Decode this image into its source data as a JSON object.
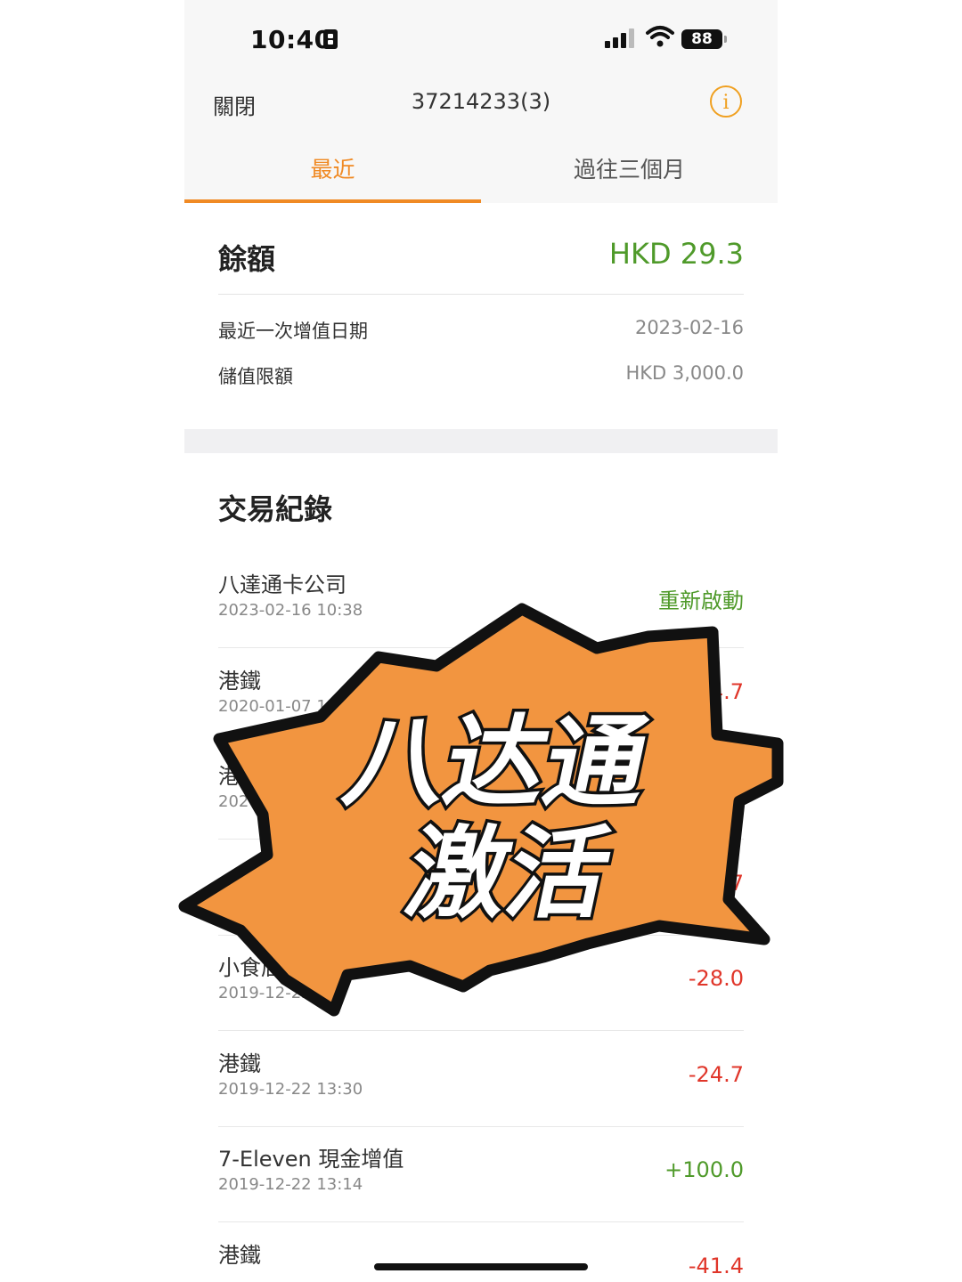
{
  "status_bar": {
    "time": "10:40",
    "battery": "88"
  },
  "nav": {
    "close_label": "關閉",
    "title": "37214233(3)",
    "info_icon": "i"
  },
  "tabs": [
    {
      "label": "最近"
    },
    {
      "label": "過往三個月"
    }
  ],
  "balance": {
    "label": "餘額",
    "value": "HKD 29.3",
    "details": [
      {
        "label": "最近一次增值日期",
        "value": "2023-02-16"
      },
      {
        "label": "儲值限額",
        "value": "HKD 3,000.0"
      }
    ]
  },
  "transactions": {
    "heading": "交易紀錄",
    "items": [
      {
        "merchant": "八達通卡公司",
        "date": "2023-02-16 10:38",
        "amount": "重新啟動",
        "kind": "pos"
      },
      {
        "merchant": "港鐵",
        "date": "2020-01-07 13:3",
        "amount": "4.7",
        "kind": "neg"
      },
      {
        "merchant": "港鐵",
        "date": "2020",
        "amount": "",
        "kind": "neg"
      },
      {
        "merchant": "",
        "date": "",
        "amount": "7",
        "kind": "neg"
      },
      {
        "merchant": "小食店",
        "date": "2019-12-22 1",
        "amount": "-28.0",
        "kind": "neg"
      },
      {
        "merchant": "港鐵",
        "date": "2019-12-22 13:30",
        "amount": "-24.7",
        "kind": "neg"
      },
      {
        "merchant": "7-Eleven 現金增值",
        "date": "2019-12-22 13:14",
        "amount": "+100.0",
        "kind": "pos"
      },
      {
        "merchant": "港鐵",
        "date": "",
        "amount": "-41.4",
        "kind": "neg"
      }
    ]
  },
  "overlay": {
    "line1": "八达通",
    "line2": "激活",
    "color": "#f29540"
  },
  "colors": {
    "accent": "#f08a24",
    "positive": "#4f9a2a",
    "negative": "#e0362a"
  }
}
